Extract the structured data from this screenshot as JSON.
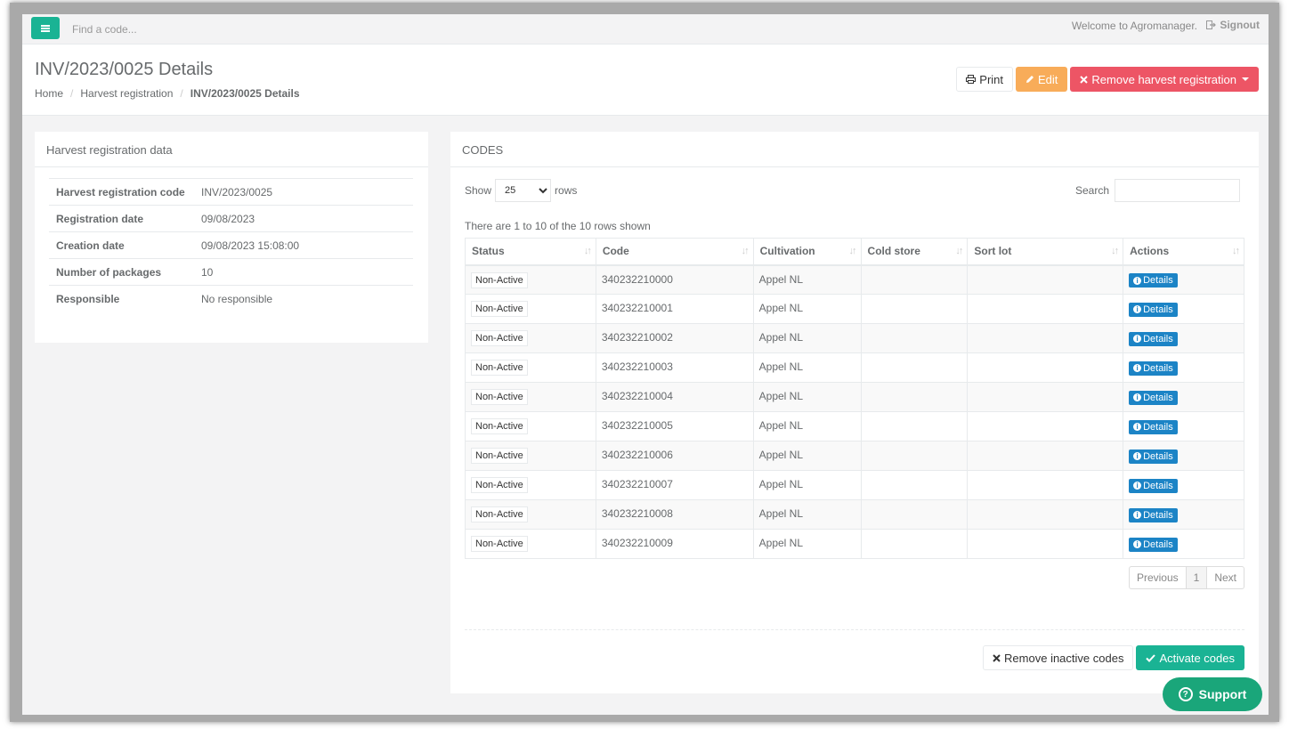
{
  "topbar": {
    "search_placeholder": "Find a code...",
    "welcome": "Welcome to Agromanager.",
    "signout": "Signout"
  },
  "header": {
    "title": "INV/2023/0025 Details",
    "breadcrumb": [
      "Home",
      "Harvest registration",
      "INV/2023/0025 Details"
    ],
    "print": "Print",
    "edit": "Edit",
    "remove": "Remove harvest registration"
  },
  "harvest": {
    "title": "Harvest registration data",
    "rows": [
      {
        "label": "Harvest registration code",
        "value": "INV/2023/0025"
      },
      {
        "label": "Registration date",
        "value": "09/08/2023"
      },
      {
        "label": "Creation date",
        "value": "09/08/2023 15:08:00"
      },
      {
        "label": "Number of packages",
        "value": "10"
      },
      {
        "label": "Responsible",
        "value": "No responsible"
      }
    ]
  },
  "codes": {
    "title": "CODES",
    "show_label": "Show",
    "rows_label": "rows",
    "page_size": "25",
    "search_label": "Search",
    "info": "There are 1 to 10 of the 10 rows shown",
    "columns": [
      "Status",
      "Code",
      "Cultivation",
      "Cold store",
      "Sort lot",
      "Actions"
    ],
    "rows": [
      {
        "status": "Non-Active",
        "code": "340232210000",
        "cultivation": "Appel NL",
        "cold_store": "",
        "sort_lot": "",
        "action": "Details"
      },
      {
        "status": "Non-Active",
        "code": "340232210001",
        "cultivation": "Appel NL",
        "cold_store": "",
        "sort_lot": "",
        "action": "Details"
      },
      {
        "status": "Non-Active",
        "code": "340232210002",
        "cultivation": "Appel NL",
        "cold_store": "",
        "sort_lot": "",
        "action": "Details"
      },
      {
        "status": "Non-Active",
        "code": "340232210003",
        "cultivation": "Appel NL",
        "cold_store": "",
        "sort_lot": "",
        "action": "Details"
      },
      {
        "status": "Non-Active",
        "code": "340232210004",
        "cultivation": "Appel NL",
        "cold_store": "",
        "sort_lot": "",
        "action": "Details"
      },
      {
        "status": "Non-Active",
        "code": "340232210005",
        "cultivation": "Appel NL",
        "cold_store": "",
        "sort_lot": "",
        "action": "Details"
      },
      {
        "status": "Non-Active",
        "code": "340232210006",
        "cultivation": "Appel NL",
        "cold_store": "",
        "sort_lot": "",
        "action": "Details"
      },
      {
        "status": "Non-Active",
        "code": "340232210007",
        "cultivation": "Appel NL",
        "cold_store": "",
        "sort_lot": "",
        "action": "Details"
      },
      {
        "status": "Non-Active",
        "code": "340232210008",
        "cultivation": "Appel NL",
        "cold_store": "",
        "sort_lot": "",
        "action": "Details"
      },
      {
        "status": "Non-Active",
        "code": "340232210009",
        "cultivation": "Appel NL",
        "cold_store": "",
        "sort_lot": "",
        "action": "Details"
      }
    ],
    "pager": {
      "previous": "Previous",
      "current": "1",
      "next": "Next"
    },
    "remove_inactive": "Remove inactive codes",
    "activate": "Activate codes"
  },
  "support": "Support",
  "colors": {
    "primary": "#1ab394",
    "warning": "#f8ac59",
    "danger": "#ed5565",
    "info": "#1c84c6"
  }
}
